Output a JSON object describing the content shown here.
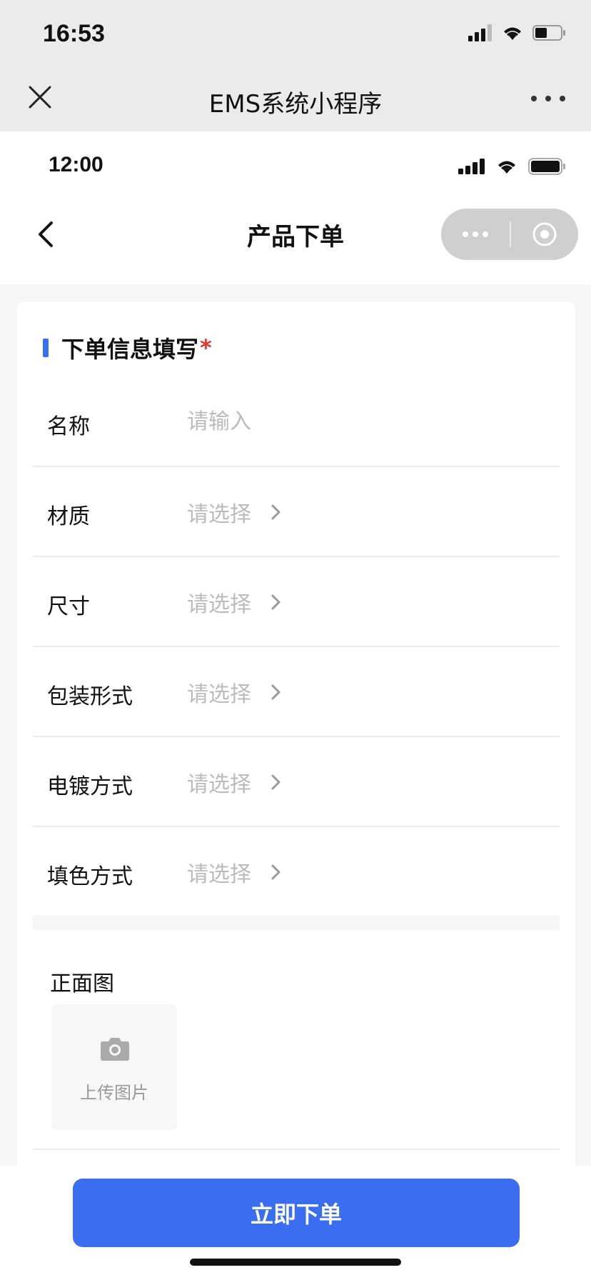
{
  "outer_status": {
    "time": "16:53"
  },
  "outer_nav": {
    "title": "EMS系统小程序"
  },
  "inner_status": {
    "time": "12:00"
  },
  "page": {
    "title": "产品下单"
  },
  "section": {
    "title": "下单信息填写",
    "required_mark": "*"
  },
  "form": {
    "name": {
      "label": "名称",
      "placeholder": "请输入",
      "value": ""
    },
    "selects": [
      {
        "label": "材质",
        "value": "请选择"
      },
      {
        "label": "尺寸",
        "value": "请选择"
      },
      {
        "label": "包装形式",
        "value": "请选择"
      },
      {
        "label": "电镀方式",
        "value": "请选择"
      },
      {
        "label": "填色方式",
        "value": "请选择"
      }
    ]
  },
  "upload": {
    "label": "正面图",
    "button_text": "上传图片"
  },
  "submit": {
    "label": "立即下单"
  },
  "colors": {
    "accent": "#3a6df0",
    "required": "#e5322d",
    "placeholder": "#bbbbbb"
  },
  "icons": [
    "close-icon",
    "more-icon",
    "back-icon",
    "capsule-more-icon",
    "capsule-close-icon",
    "chevron-right-icon",
    "camera-icon",
    "signal-icon",
    "wifi-icon",
    "battery-icon"
  ]
}
